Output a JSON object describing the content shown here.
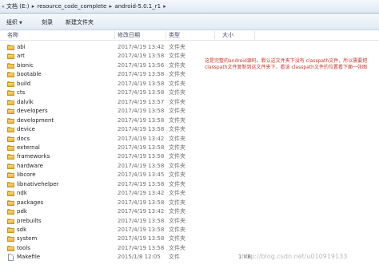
{
  "address_bar": {
    "crumbs": [
      "文档 (E:)",
      "resource_code_complete",
      "android-5.0.1_r1"
    ]
  },
  "toolbar": {
    "organize_label": "组织",
    "share_label": "刻录",
    "new_folder_label": "新建文件夹"
  },
  "columns": {
    "name": "名称",
    "date": "修改日期",
    "type": "类型",
    "size": "大小"
  },
  "files": [
    {
      "name": "abi",
      "date": "2017/4/19 13:42",
      "type": "文件夹",
      "size": "",
      "icon": "folder-icon"
    },
    {
      "name": "art",
      "date": "2017/4/19 13:58",
      "type": "文件夹",
      "size": "",
      "icon": "folder-icon"
    },
    {
      "name": "bionic",
      "date": "2017/4/19 13:56",
      "type": "文件夹",
      "size": "",
      "icon": "folder-icon"
    },
    {
      "name": "bootable",
      "date": "2017/4/19 13:58",
      "type": "文件夹",
      "size": "",
      "icon": "folder-icon"
    },
    {
      "name": "build",
      "date": "2017/4/19 13:58",
      "type": "文件夹",
      "size": "",
      "icon": "folder-icon"
    },
    {
      "name": "cts",
      "date": "2017/4/19 13:58",
      "type": "文件夹",
      "size": "",
      "icon": "folder-icon"
    },
    {
      "name": "dalvik",
      "date": "2017/4/19 13:57",
      "type": "文件夹",
      "size": "",
      "icon": "folder-icon"
    },
    {
      "name": "developers",
      "date": "2017/4/19 13:58",
      "type": "文件夹",
      "size": "",
      "icon": "folder-icon"
    },
    {
      "name": "development",
      "date": "2017/4/19 13:58",
      "type": "文件夹",
      "size": "",
      "icon": "folder-icon"
    },
    {
      "name": "device",
      "date": "2017/4/19 13:58",
      "type": "文件夹",
      "size": "",
      "icon": "folder-icon"
    },
    {
      "name": "docs",
      "date": "2017/4/19 13:42",
      "type": "文件夹",
      "size": "",
      "icon": "folder-icon"
    },
    {
      "name": "external",
      "date": "2017/4/19 13:58",
      "type": "文件夹",
      "size": "",
      "icon": "folder-icon"
    },
    {
      "name": "frameworks",
      "date": "2017/4/19 13:58",
      "type": "文件夹",
      "size": "",
      "icon": "folder-icon"
    },
    {
      "name": "hardware",
      "date": "2017/4/19 13:58",
      "type": "文件夹",
      "size": "",
      "icon": "folder-icon"
    },
    {
      "name": "libcore",
      "date": "2017/4/19 13:45",
      "type": "文件夹",
      "size": "",
      "icon": "folder-icon"
    },
    {
      "name": "libnativehelper",
      "date": "2017/4/19 13:58",
      "type": "文件夹",
      "size": "",
      "icon": "folder-icon"
    },
    {
      "name": "ndk",
      "date": "2017/4/19 13:42",
      "type": "文件夹",
      "size": "",
      "icon": "folder-icon"
    },
    {
      "name": "packages",
      "date": "2017/4/19 13:58",
      "type": "文件夹",
      "size": "",
      "icon": "folder-icon"
    },
    {
      "name": "pdk",
      "date": "2017/4/19 13:42",
      "type": "文件夹",
      "size": "",
      "icon": "folder-icon"
    },
    {
      "name": "prebuilts",
      "date": "2017/4/19 13:58",
      "type": "文件夹",
      "size": "",
      "icon": "folder-icon"
    },
    {
      "name": "sdk",
      "date": "2017/4/19 13:58",
      "type": "文件夹",
      "size": "",
      "icon": "folder-icon"
    },
    {
      "name": "system",
      "date": "2017/4/19 13:58",
      "type": "文件夹",
      "size": "",
      "icon": "folder-icon"
    },
    {
      "name": "tools",
      "date": "2017/4/19 13:58",
      "type": "文件夹",
      "size": "",
      "icon": "folder-icon"
    },
    {
      "name": "Makefile",
      "date": "2015/1/8 12:05",
      "type": "文件",
      "size": "1 KB",
      "icon": "file-icon"
    }
  ],
  "annotation": "这是完整的android源码，默认这文件夹下没有 classpath文件，所以需要把classpath文件复制到这文件夹下，看该 classpath文件的位置看下面一张图",
  "watermark": "http://blog.csdn.net/u010919133",
  "colors": {
    "annotation": "#c0392b",
    "folder": "#f2c85b",
    "header_text": "#3e4c5e"
  }
}
